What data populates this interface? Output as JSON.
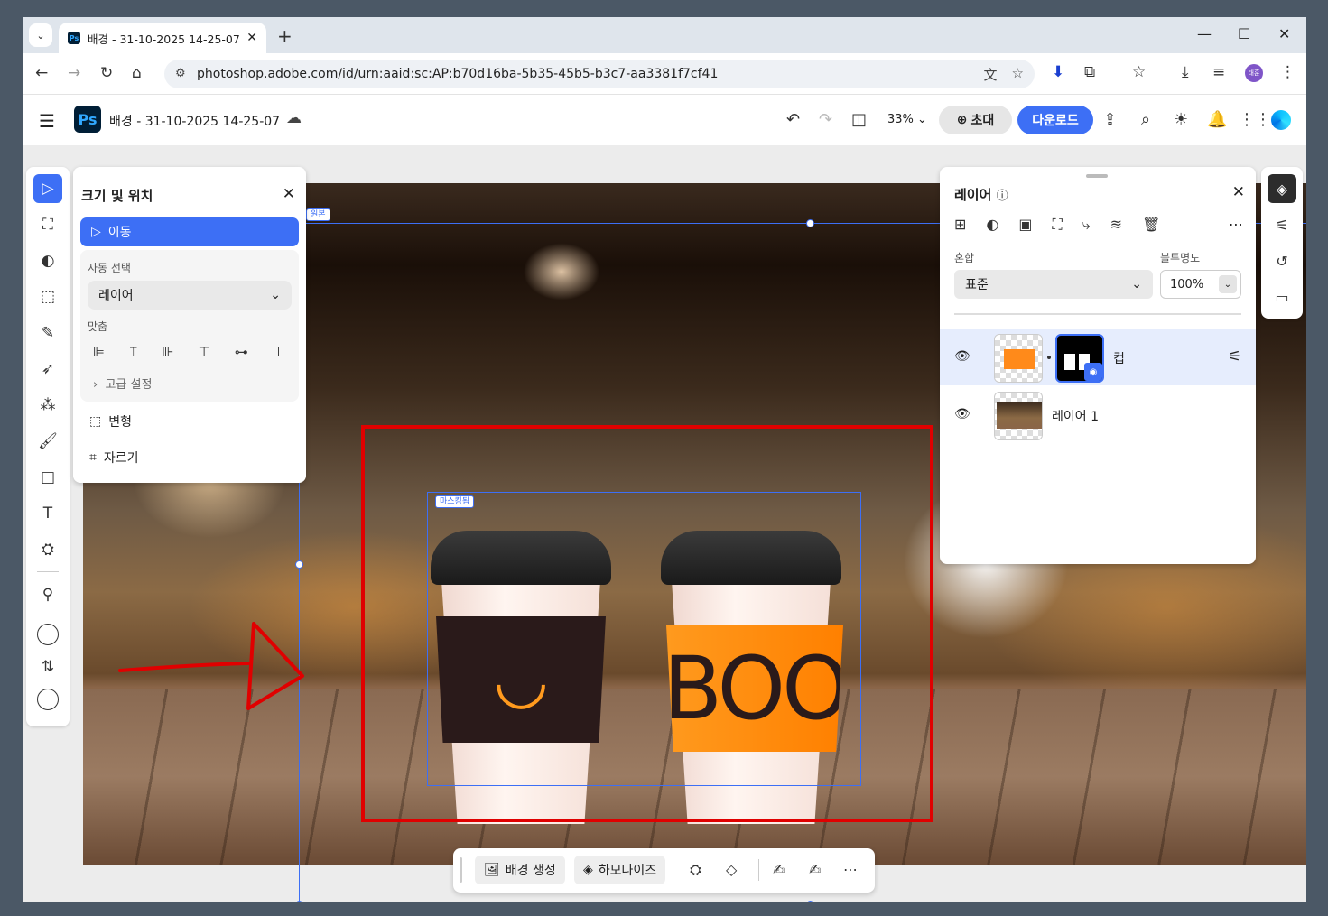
{
  "browser": {
    "tab_title": "배경 - 31-10-2025 14-25-07 - ",
    "tab_favicon": "Ps",
    "url": "photoshop.adobe.com/id/urn:aaid:sc:AP:b70d16ba-5b35-45b5-b3c7-aa3381f7cf41",
    "avatar_text": "태훈"
  },
  "header": {
    "logo": "Ps",
    "doc_title": "배경 - 31-10-2025 14-25-07",
    "zoom": "33%",
    "invite_label": "초대",
    "download_label": "다운로드"
  },
  "left_panel": {
    "title": "크기 및 위치",
    "move_label": "이동",
    "auto_select_label": "자동 선택",
    "auto_select_value": "레이어",
    "align_label": "맞춤",
    "advanced_label": "고급 설정",
    "transform_label": "변형",
    "crop_label": "자르기"
  },
  "canvas": {
    "original_tag": "원본",
    "masked_tag": "마스킹됨",
    "sleeve_text": "BOO"
  },
  "layers_panel": {
    "title": "레이어",
    "blend_label": "혼합",
    "blend_value": "표준",
    "opacity_label": "불투명도",
    "opacity_value": "100%",
    "layers": [
      {
        "name": "컵",
        "selected": true
      },
      {
        "name": "레이어 1",
        "selected": false
      }
    ]
  },
  "context_bar": {
    "generate_bg_label": "배경 생성",
    "harmonize_label": "하모나이즈"
  },
  "colors": {
    "accent": "#3d6ff5",
    "annotation_red": "#e00000"
  }
}
